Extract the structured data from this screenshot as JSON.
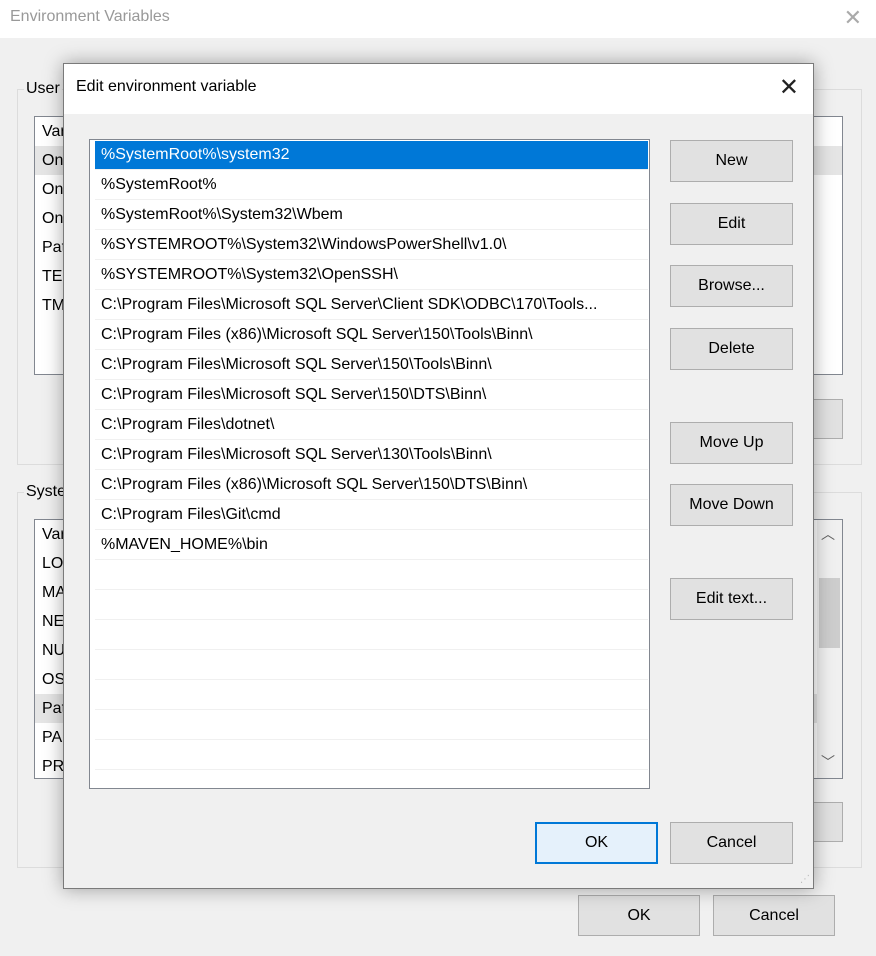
{
  "outer": {
    "title": "Environment Variables",
    "close_icon": "close-icon",
    "user_group": "User",
    "user_rows": [
      "Var",
      "On",
      "On",
      "On",
      "Pat",
      "TEI",
      "TM"
    ],
    "system_group": "Syste",
    "system_rows": [
      "Var",
      "LO",
      "MA",
      "NE",
      "NU",
      "OS",
      "Pat",
      "PA",
      "PR"
    ],
    "ok": "OK",
    "cancel": "Cancel"
  },
  "dialog": {
    "title": "Edit environment variable",
    "selected_color": "#0078d7",
    "entries": [
      "%SystemRoot%\\system32",
      "%SystemRoot%",
      "%SystemRoot%\\System32\\Wbem",
      "%SYSTEMROOT%\\System32\\WindowsPowerShell\\v1.0\\",
      "%SYSTEMROOT%\\System32\\OpenSSH\\",
      "C:\\Program Files\\Microsoft SQL Server\\Client SDK\\ODBC\\170\\Tools...",
      "C:\\Program Files (x86)\\Microsoft SQL Server\\150\\Tools\\Binn\\",
      "C:\\Program Files\\Microsoft SQL Server\\150\\Tools\\Binn\\",
      "C:\\Program Files\\Microsoft SQL Server\\150\\DTS\\Binn\\",
      "C:\\Program Files\\dotnet\\",
      "C:\\Program Files\\Microsoft SQL Server\\130\\Tools\\Binn\\",
      "C:\\Program Files (x86)\\Microsoft SQL Server\\150\\DTS\\Binn\\",
      "C:\\Program Files\\Git\\cmd",
      "%MAVEN_HOME%\\bin"
    ],
    "buttons": {
      "new": "New",
      "edit": "Edit",
      "browse": "Browse...",
      "delete": "Delete",
      "move_up": "Move Up",
      "move_down": "Move Down",
      "edit_text": "Edit text...",
      "ok": "OK",
      "cancel": "Cancel"
    }
  }
}
